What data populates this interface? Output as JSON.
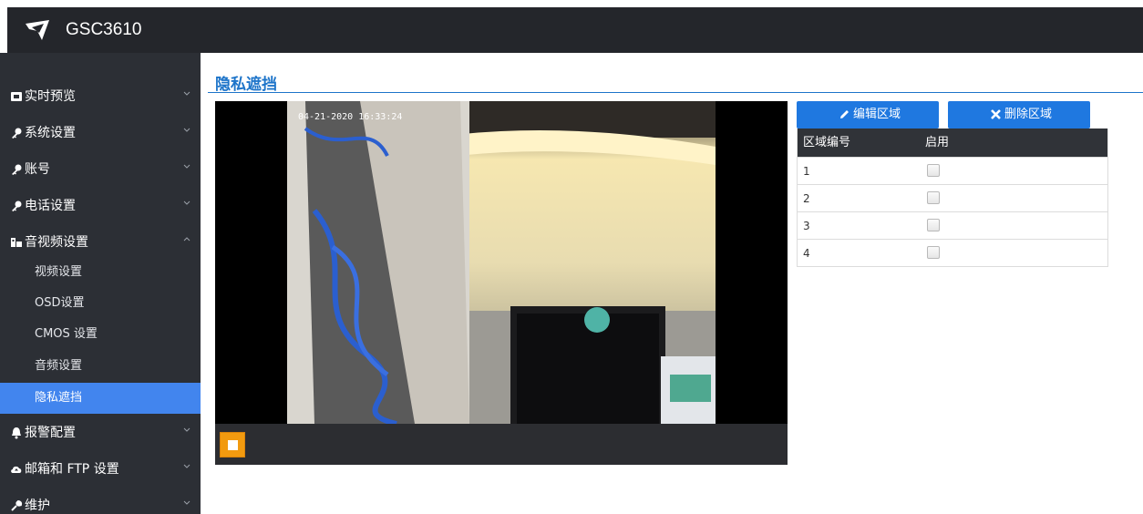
{
  "header": {
    "product": "GSC3610"
  },
  "sidebar": {
    "items": [
      {
        "label": "实时预览",
        "icon": "monitor-icon"
      },
      {
        "label": "系统设置",
        "icon": "key-icon"
      },
      {
        "label": "账号",
        "icon": "key-icon"
      },
      {
        "label": "电话设置",
        "icon": "key-icon"
      },
      {
        "label": "音视频设置",
        "icon": "film-icon",
        "expanded": true
      },
      {
        "label": "报警配置",
        "icon": "bell-icon"
      },
      {
        "label": "邮箱和 FTP 设置",
        "icon": "cloud-upload-icon"
      },
      {
        "label": "维护",
        "icon": "wrench-icon"
      }
    ],
    "subitems": [
      "视频设置",
      "OSD设置",
      "CMOS 设置",
      "音频设置",
      "隐私遮挡"
    ],
    "active_subitem": "隐私遮挡"
  },
  "main": {
    "title": "隐私遮挡",
    "video": {
      "timestamp": "04-21-2020 16:33:24"
    },
    "edit_button": "编辑区域",
    "delete_button": "删除区域",
    "table": {
      "headers": [
        "区域编号",
        "启用"
      ],
      "rows": [
        {
          "id": "1",
          "enabled": false
        },
        {
          "id": "2",
          "enabled": false
        },
        {
          "id": "3",
          "enabled": false
        },
        {
          "id": "4",
          "enabled": false
        }
      ]
    }
  },
  "colors": {
    "topbar": "#24262b",
    "sidebar": "#2c2f35",
    "active": "#4285ee",
    "title": "#1d74c9",
    "button": "#1f78e0",
    "stop": "#f29a0f"
  }
}
